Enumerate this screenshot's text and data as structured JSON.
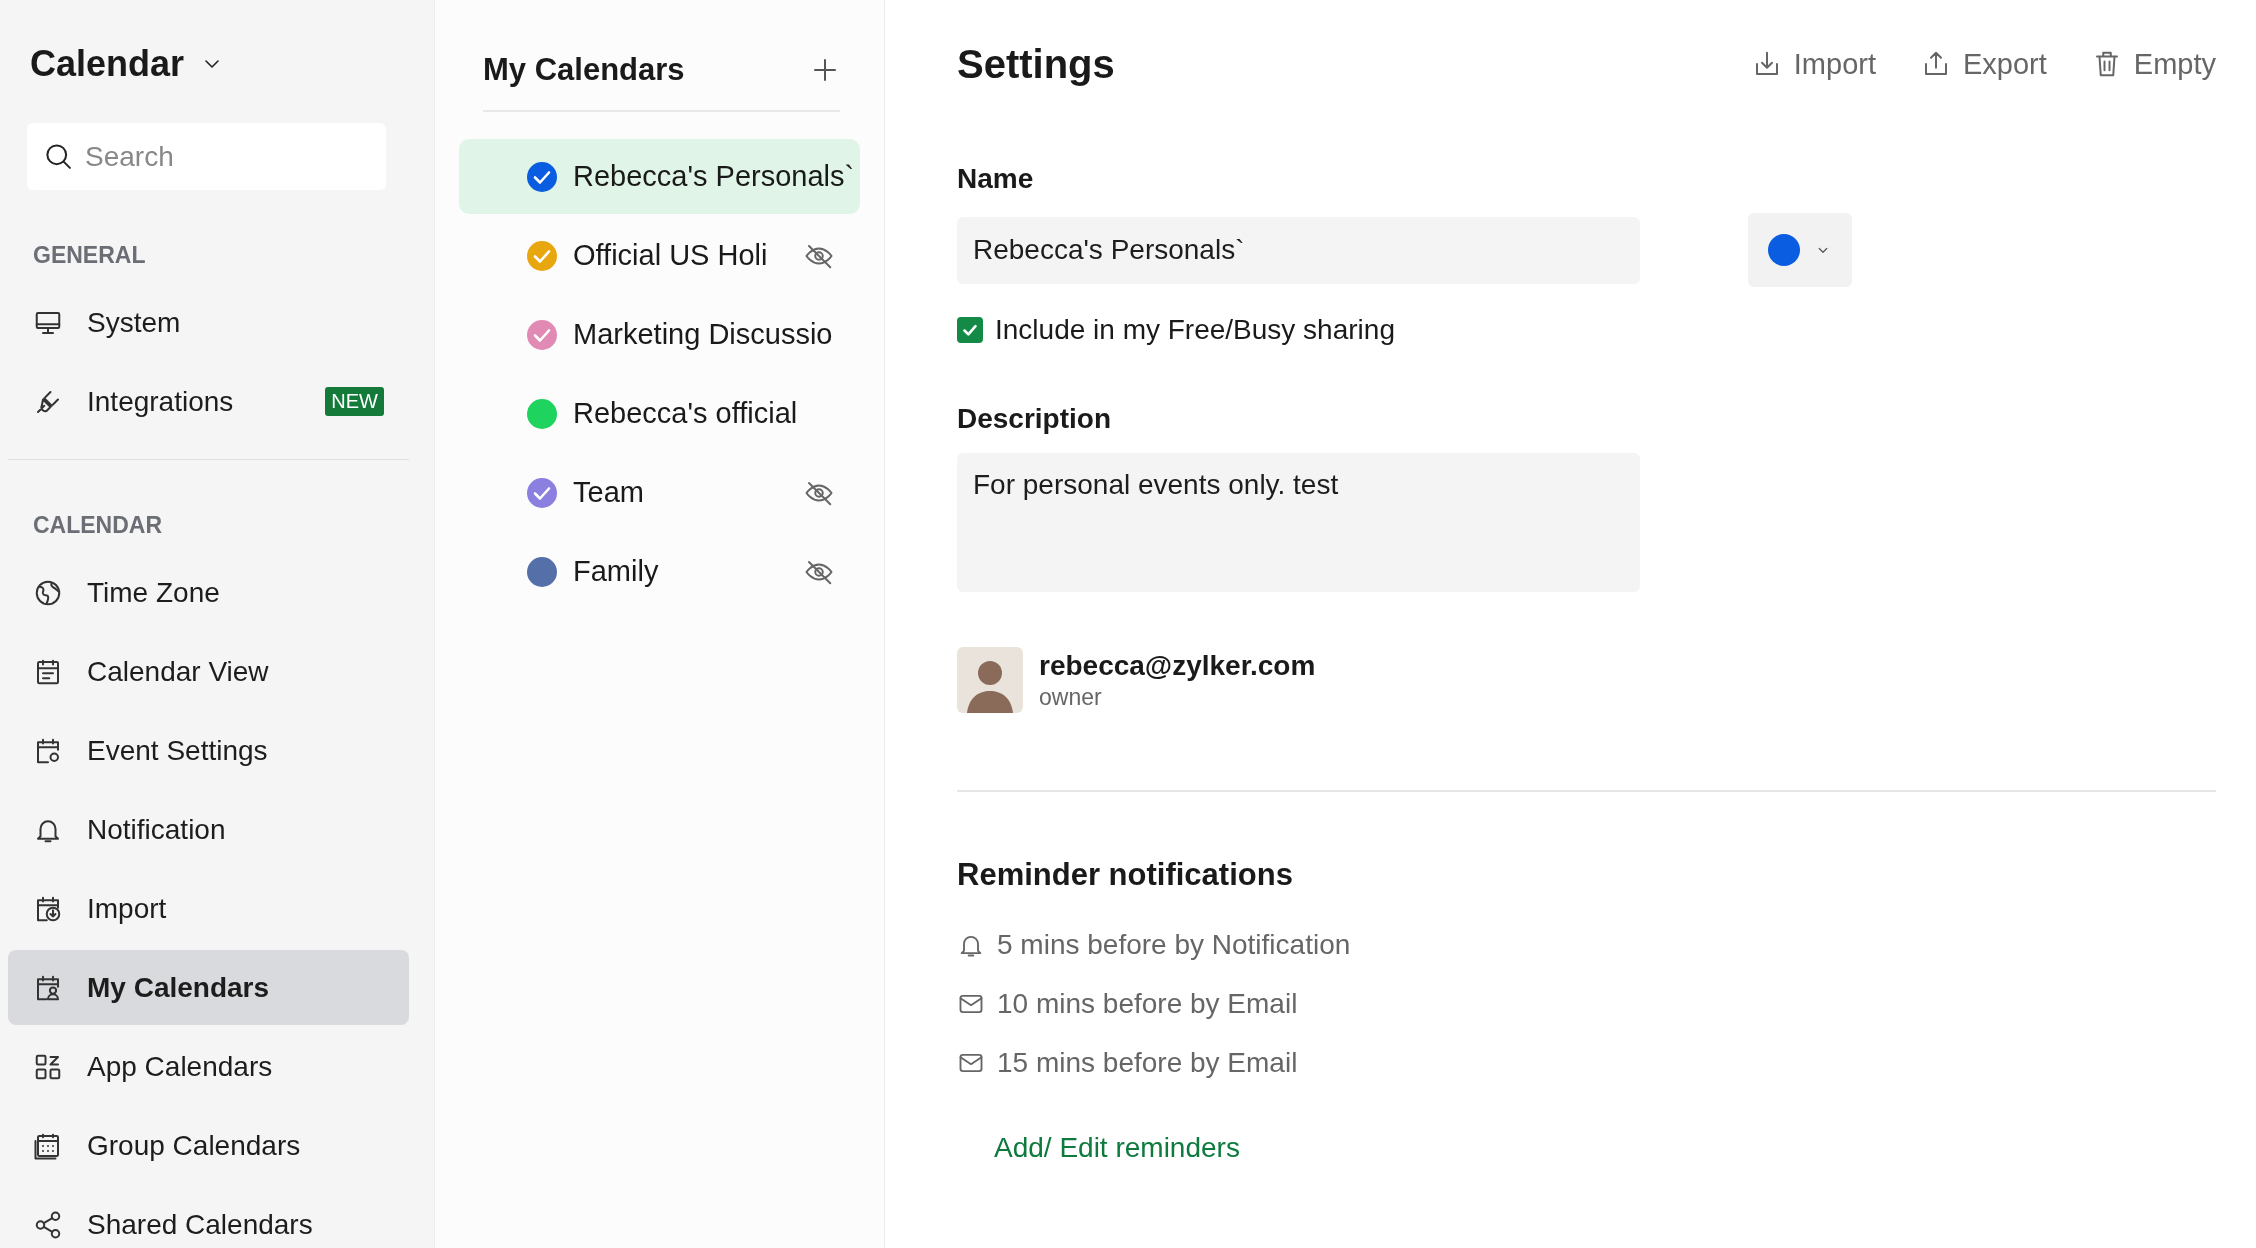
{
  "app": {
    "title": "Calendar"
  },
  "sidebar": {
    "search": {
      "placeholder": "Search"
    },
    "sections": [
      {
        "heading": "GENERAL",
        "items": [
          {
            "label": "System",
            "selected": false
          },
          {
            "label": "Integrations",
            "selected": false,
            "badge": "NEW"
          }
        ]
      },
      {
        "heading": "CALENDAR",
        "items": [
          {
            "label": "Time Zone",
            "selected": false
          },
          {
            "label": "Calendar View",
            "selected": false
          },
          {
            "label": "Event Settings",
            "selected": false
          },
          {
            "label": "Notification",
            "selected": false
          },
          {
            "label": "Import",
            "selected": false
          },
          {
            "label": "My Calendars",
            "selected": true
          },
          {
            "label": "App Calendars",
            "selected": false
          },
          {
            "label": "Group Calendars",
            "selected": false
          },
          {
            "label": "Shared Calendars",
            "selected": false
          }
        ]
      }
    ]
  },
  "calendars": {
    "title": "My Calendars",
    "items": [
      {
        "name": "Rebecca's Personals`",
        "color": "#0a5ce0",
        "checked": true,
        "hidden": false,
        "selected": true
      },
      {
        "name": "Official US Holi",
        "color": "#e8a70f",
        "checked": true,
        "hidden": true,
        "selected": false
      },
      {
        "name": "Marketing Discussio",
        "color": "#e08ab4",
        "checked": true,
        "hidden": false,
        "selected": false
      },
      {
        "name": "Rebecca's official",
        "color": "#1ed35e",
        "checked": false,
        "hidden": false,
        "selected": false
      },
      {
        "name": "Team",
        "color": "#8b7fe0",
        "checked": true,
        "hidden": true,
        "selected": false
      },
      {
        "name": "Family",
        "color": "#5570a8",
        "checked": false,
        "hidden": true,
        "selected": false
      }
    ]
  },
  "settings": {
    "title": "Settings",
    "actions": [
      "Import",
      "Export",
      "Empty"
    ],
    "name_label": "Name",
    "name_value": "Rebecca's Personals`",
    "color": "#0a5ce0",
    "free_busy": {
      "label": "Include in my Free/Busy sharing",
      "checked": true
    },
    "description_label": "Description",
    "description_value": "For personal events only. test",
    "owner": {
      "email": "rebecca@zylker.com",
      "role": "owner"
    },
    "reminders": {
      "title": "Reminder notifications",
      "items": [
        {
          "text": "5 mins before by Notification",
          "kind": "notification"
        },
        {
          "text": "10 mins before by Email",
          "kind": "email"
        },
        {
          "text": "15 mins before by Email",
          "kind": "email"
        }
      ],
      "link": "Add/ Edit reminders"
    }
  }
}
